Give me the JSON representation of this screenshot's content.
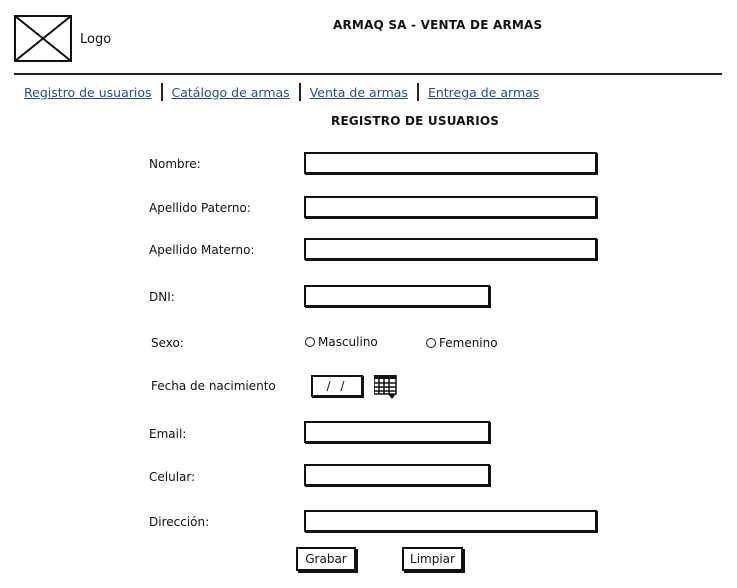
{
  "header": {
    "logo_label": "Logo",
    "title": "ARMAQ SA - VENTA DE ARMAS"
  },
  "nav": {
    "items": [
      {
        "label": "Registro de usuarios"
      },
      {
        "label": "Catálogo de armas"
      },
      {
        "label": "Venta de armas"
      },
      {
        "label": "Entrega de armas"
      }
    ]
  },
  "form": {
    "title": "REGISTRO DE USUARIOS",
    "nombre_label": "Nombre:",
    "apellido_paterno_label": "Apellido Paterno:",
    "apellido_materno_label": "Apellido Materno:",
    "dni_label": "DNI:",
    "sexo_label": "Sexo:",
    "sexo_options": [
      "Masculino",
      "Femenino"
    ],
    "fecha_label": "Fecha de nacimiento",
    "fecha_value": "/ /",
    "email_label": "Email:",
    "celular_label": "Celular:",
    "direccion_label": "Dirección:",
    "grabar_label": "Grabar",
    "limpiar_label": "Limpiar"
  },
  "icons": {
    "logo": "image-placeholder-icon",
    "calendar": "calendar-icon"
  }
}
